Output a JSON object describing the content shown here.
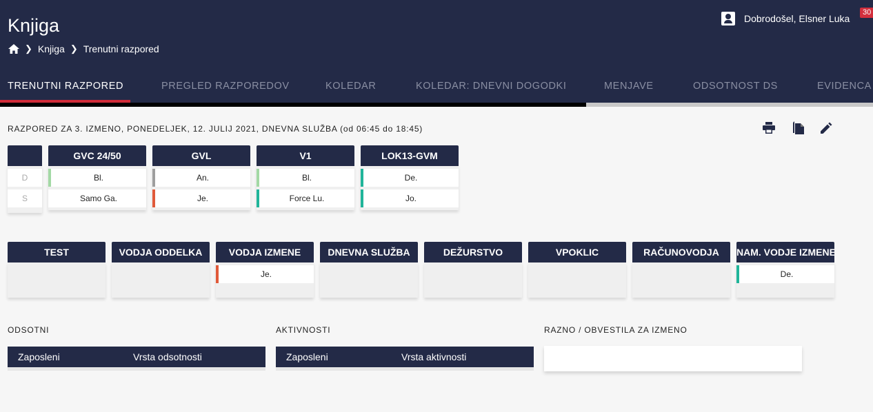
{
  "app": {
    "title": "Knjiga"
  },
  "breadcrumb": {
    "items": [
      "Knjiga",
      "Trenutni razpored"
    ]
  },
  "user": {
    "greeting": "Dobrodošel, Elsner Luka",
    "badge": "30"
  },
  "tabs": [
    {
      "label": "TRENUTNI RAZPORED",
      "active": true
    },
    {
      "label": "PREGLED RAZPOREDOV"
    },
    {
      "label": "KOLEDAR"
    },
    {
      "label": "KOLEDAR: DNEVNI DOGODKI"
    },
    {
      "label": "MENJAVE"
    },
    {
      "label": "ODSOTNOST DS"
    },
    {
      "label": "EVIDENCA"
    }
  ],
  "schedule": {
    "title": "RAZPORED ZA 3. IZMENO, PONEDELJEK, 12. JULIJ 2021, DNEVNA SLUŽBA (od 06:45 do 18:45)",
    "row_labels": [
      "D",
      "S"
    ],
    "columns": [
      {
        "name": "GVC 24/50",
        "cells": [
          {
            "text": "Bl.",
            "color": "#a3d9a5"
          },
          {
            "text": "Samo Ga.",
            "color": ""
          }
        ]
      },
      {
        "name": "GVL",
        "cells": [
          {
            "text": "An.",
            "color": "#9e9e9e"
          },
          {
            "text": "Je.",
            "color": "#e05a3a"
          }
        ]
      },
      {
        "name": "V1",
        "cells": [
          {
            "text": "Bl.",
            "color": "#a3d9a5"
          },
          {
            "text": "Force Lu.",
            "color": "#20b59a"
          }
        ]
      },
      {
        "name": "LOK13-GVM",
        "cells": [
          {
            "text": "De.",
            "color": "#20b59a"
          },
          {
            "text": "Jo.",
            "color": "#20b59a"
          }
        ]
      }
    ]
  },
  "roles": [
    {
      "name": "TEST",
      "cells": []
    },
    {
      "name": "VODJA ODDELKA",
      "cells": []
    },
    {
      "name": "VODJA IZMENE",
      "cells": [
        {
          "text": "Je.",
          "color": "#e05a3a"
        }
      ]
    },
    {
      "name": "DNEVNA SLUŽBA",
      "cells": []
    },
    {
      "name": "DEŽURSTVO",
      "cells": []
    },
    {
      "name": "VPOKLIC",
      "cells": []
    },
    {
      "name": "RAČUNOVODJA",
      "cells": []
    },
    {
      "name": "NAM. VODJE IZMENE",
      "cells": [
        {
          "text": "De.",
          "color": "#20b59a"
        }
      ]
    }
  ],
  "absent": {
    "title": "ODSOTNI",
    "col1": "Zaposleni",
    "col2": "Vrsta odsotnosti"
  },
  "activities": {
    "title": "AKTIVNOSTI",
    "col1": "Zaposleni",
    "col2": "Vrsta aktivnosti"
  },
  "notes": {
    "title": "RAZNO / OBVESTILA ZA IZMENO"
  },
  "icons": [
    "home-icon",
    "chevron-right-icon",
    "account-icon",
    "print-icon",
    "copy-icon",
    "edit-icon"
  ]
}
